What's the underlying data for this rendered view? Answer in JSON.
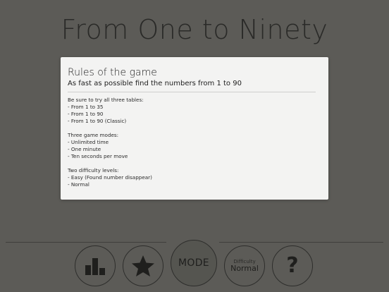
{
  "title": "From One to Ninety",
  "modal": {
    "title": "Rules of the game",
    "subtitle": "As fast as possible find the numbers from 1 to 90",
    "sections": [
      {
        "heading": "Be sure to try all three tables:",
        "items": [
          "- From 1 to 35",
          "- From 1 to 90",
          "- From 1 to 90 (Classic)"
        ]
      },
      {
        "heading": "Three game modes:",
        "items": [
          "- Unlimited time",
          "- One minute",
          "- Ten seconds per move"
        ]
      },
      {
        "heading": "Two difficulty levels:",
        "items": [
          "- Easy (Found number disappear)",
          "- Normal"
        ]
      }
    ]
  },
  "nav": {
    "mode_label": "MODE",
    "difficulty_label": "Difficulty",
    "difficulty_value": "Normal",
    "help_glyph": "?",
    "icons": {
      "stats": "bar-chart-icon",
      "favorites": "star-icon",
      "help": "question-mark-icon"
    }
  },
  "colors": {
    "background": "#5c5b57",
    "modal": "#f3f3f2",
    "ink": "#1f1f1d"
  }
}
